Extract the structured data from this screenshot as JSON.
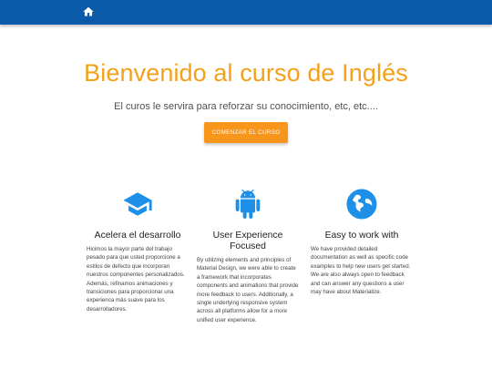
{
  "navbar": {
    "home_icon": "home-icon"
  },
  "hero": {
    "title": "Bienvenido al curso de Inglés",
    "subtitle": "El curos le servira para reforzar su conocimiento, etc, etc....",
    "button_label": "Comenzar el curso"
  },
  "features": [
    {
      "icon": "graduation-cap-icon",
      "title": "Acelera el desarrollo",
      "text": "Hicimos la mayor parte del trabajo pesado para que usted proporcione a estilos de defecto que incorporan nuestros componentes personalizados. Además, refinamos animaciones y transiciones para proporcionar una experienca más suave para los desarrolladores."
    },
    {
      "icon": "android-icon",
      "title": "User Experience Focused",
      "text": "By utilizing elements and principles of Material Design, we were able to create a framework that incorporates components and animations that provide more feedback to users. Additionally, a single underlying responsive system across all platforms allow for a more unified user experience."
    },
    {
      "icon": "globe-icon",
      "title": "Easy to work with",
      "text": "We have provided detailed documentation as well as specific code examples to help new users get started. We are also always open to feedback and can answer any questions a user may have about Materialize."
    }
  ],
  "colors": {
    "navbar": "#0b59a9",
    "accent": "#f5a01a",
    "icon_blue": "#1e90e8"
  }
}
